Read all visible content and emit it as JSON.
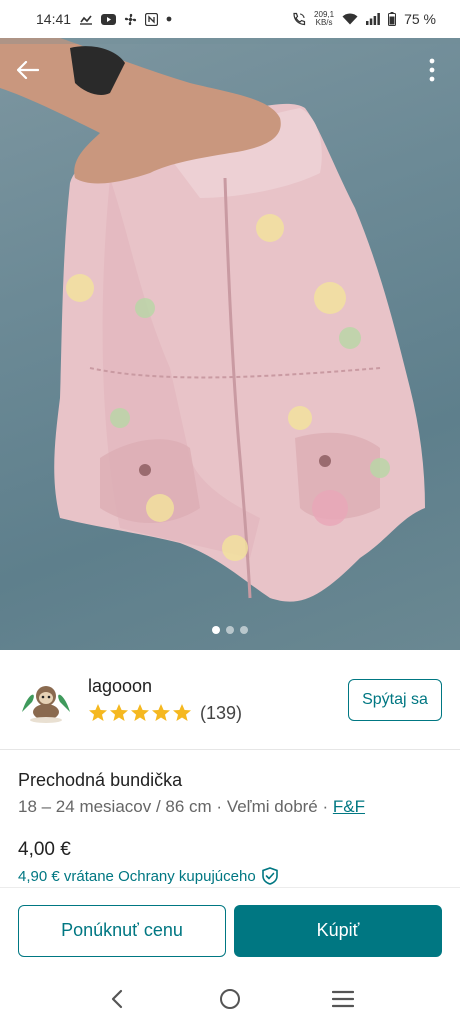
{
  "status_bar": {
    "time": "14:41",
    "net_speed_value": "209,1",
    "net_speed_unit": "KB/s",
    "battery": "75 %"
  },
  "photo": {
    "page_count": 3,
    "active_page": 1
  },
  "seller": {
    "name": "lagooon",
    "rating_stars": 5,
    "review_count": "(139)",
    "ask_label": "Spýtaj sa"
  },
  "item": {
    "title": "Prechodná bundička",
    "meta": "18 – 24 mesiacov / 86 cm · Veľmi dobré · ",
    "brand": "F&F",
    "price": "4,00 €",
    "protection_price": "4,90 € vrátane Ochrany kupujúceho"
  },
  "actions": {
    "offer_label": "Ponúknuť cenu",
    "buy_label": "Kúpiť"
  },
  "colors": {
    "accent": "#007782",
    "star": "#f5b820"
  }
}
